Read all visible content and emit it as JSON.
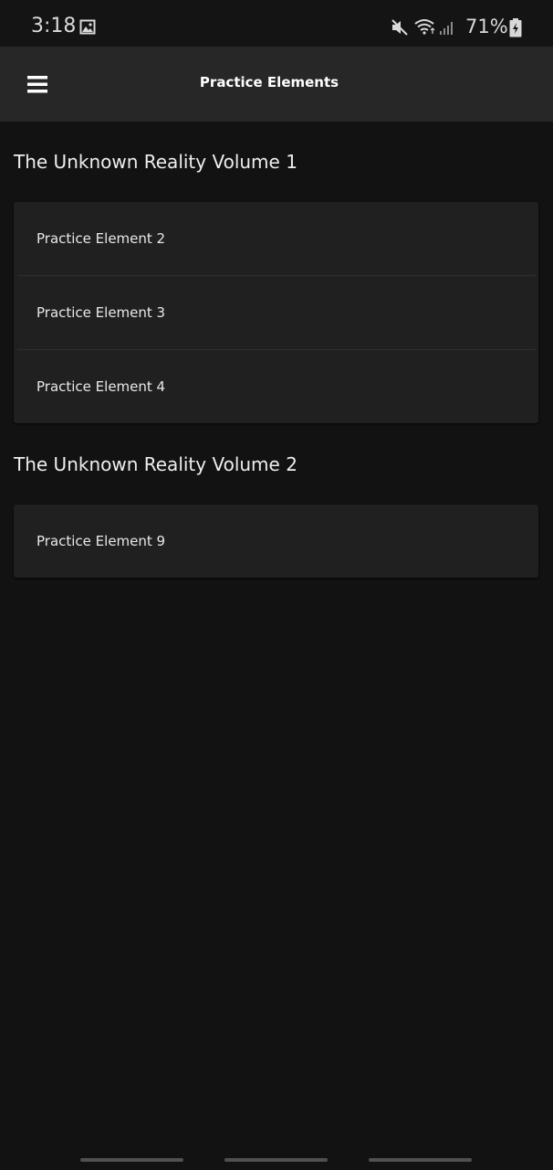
{
  "status_bar": {
    "time": "3:18",
    "battery": "71%",
    "icons": [
      "gallery-icon",
      "mute-icon",
      "wifi-icon",
      "signal-icon",
      "battery-icon"
    ]
  },
  "app_bar": {
    "title": "Practice Elements",
    "menu_icon": "menu-icon"
  },
  "sections": [
    {
      "title": "The Unknown Reality Volume 1",
      "items": [
        "Practice Element 2",
        "Practice Element 3",
        "Practice Element 4"
      ]
    },
    {
      "title": "The Unknown Reality Volume 2",
      "items": [
        "Practice Element 9"
      ]
    }
  ],
  "colors": {
    "background": "#121212",
    "app_bar": "#272727",
    "card": "#202020",
    "text": "#e8e8e8"
  }
}
